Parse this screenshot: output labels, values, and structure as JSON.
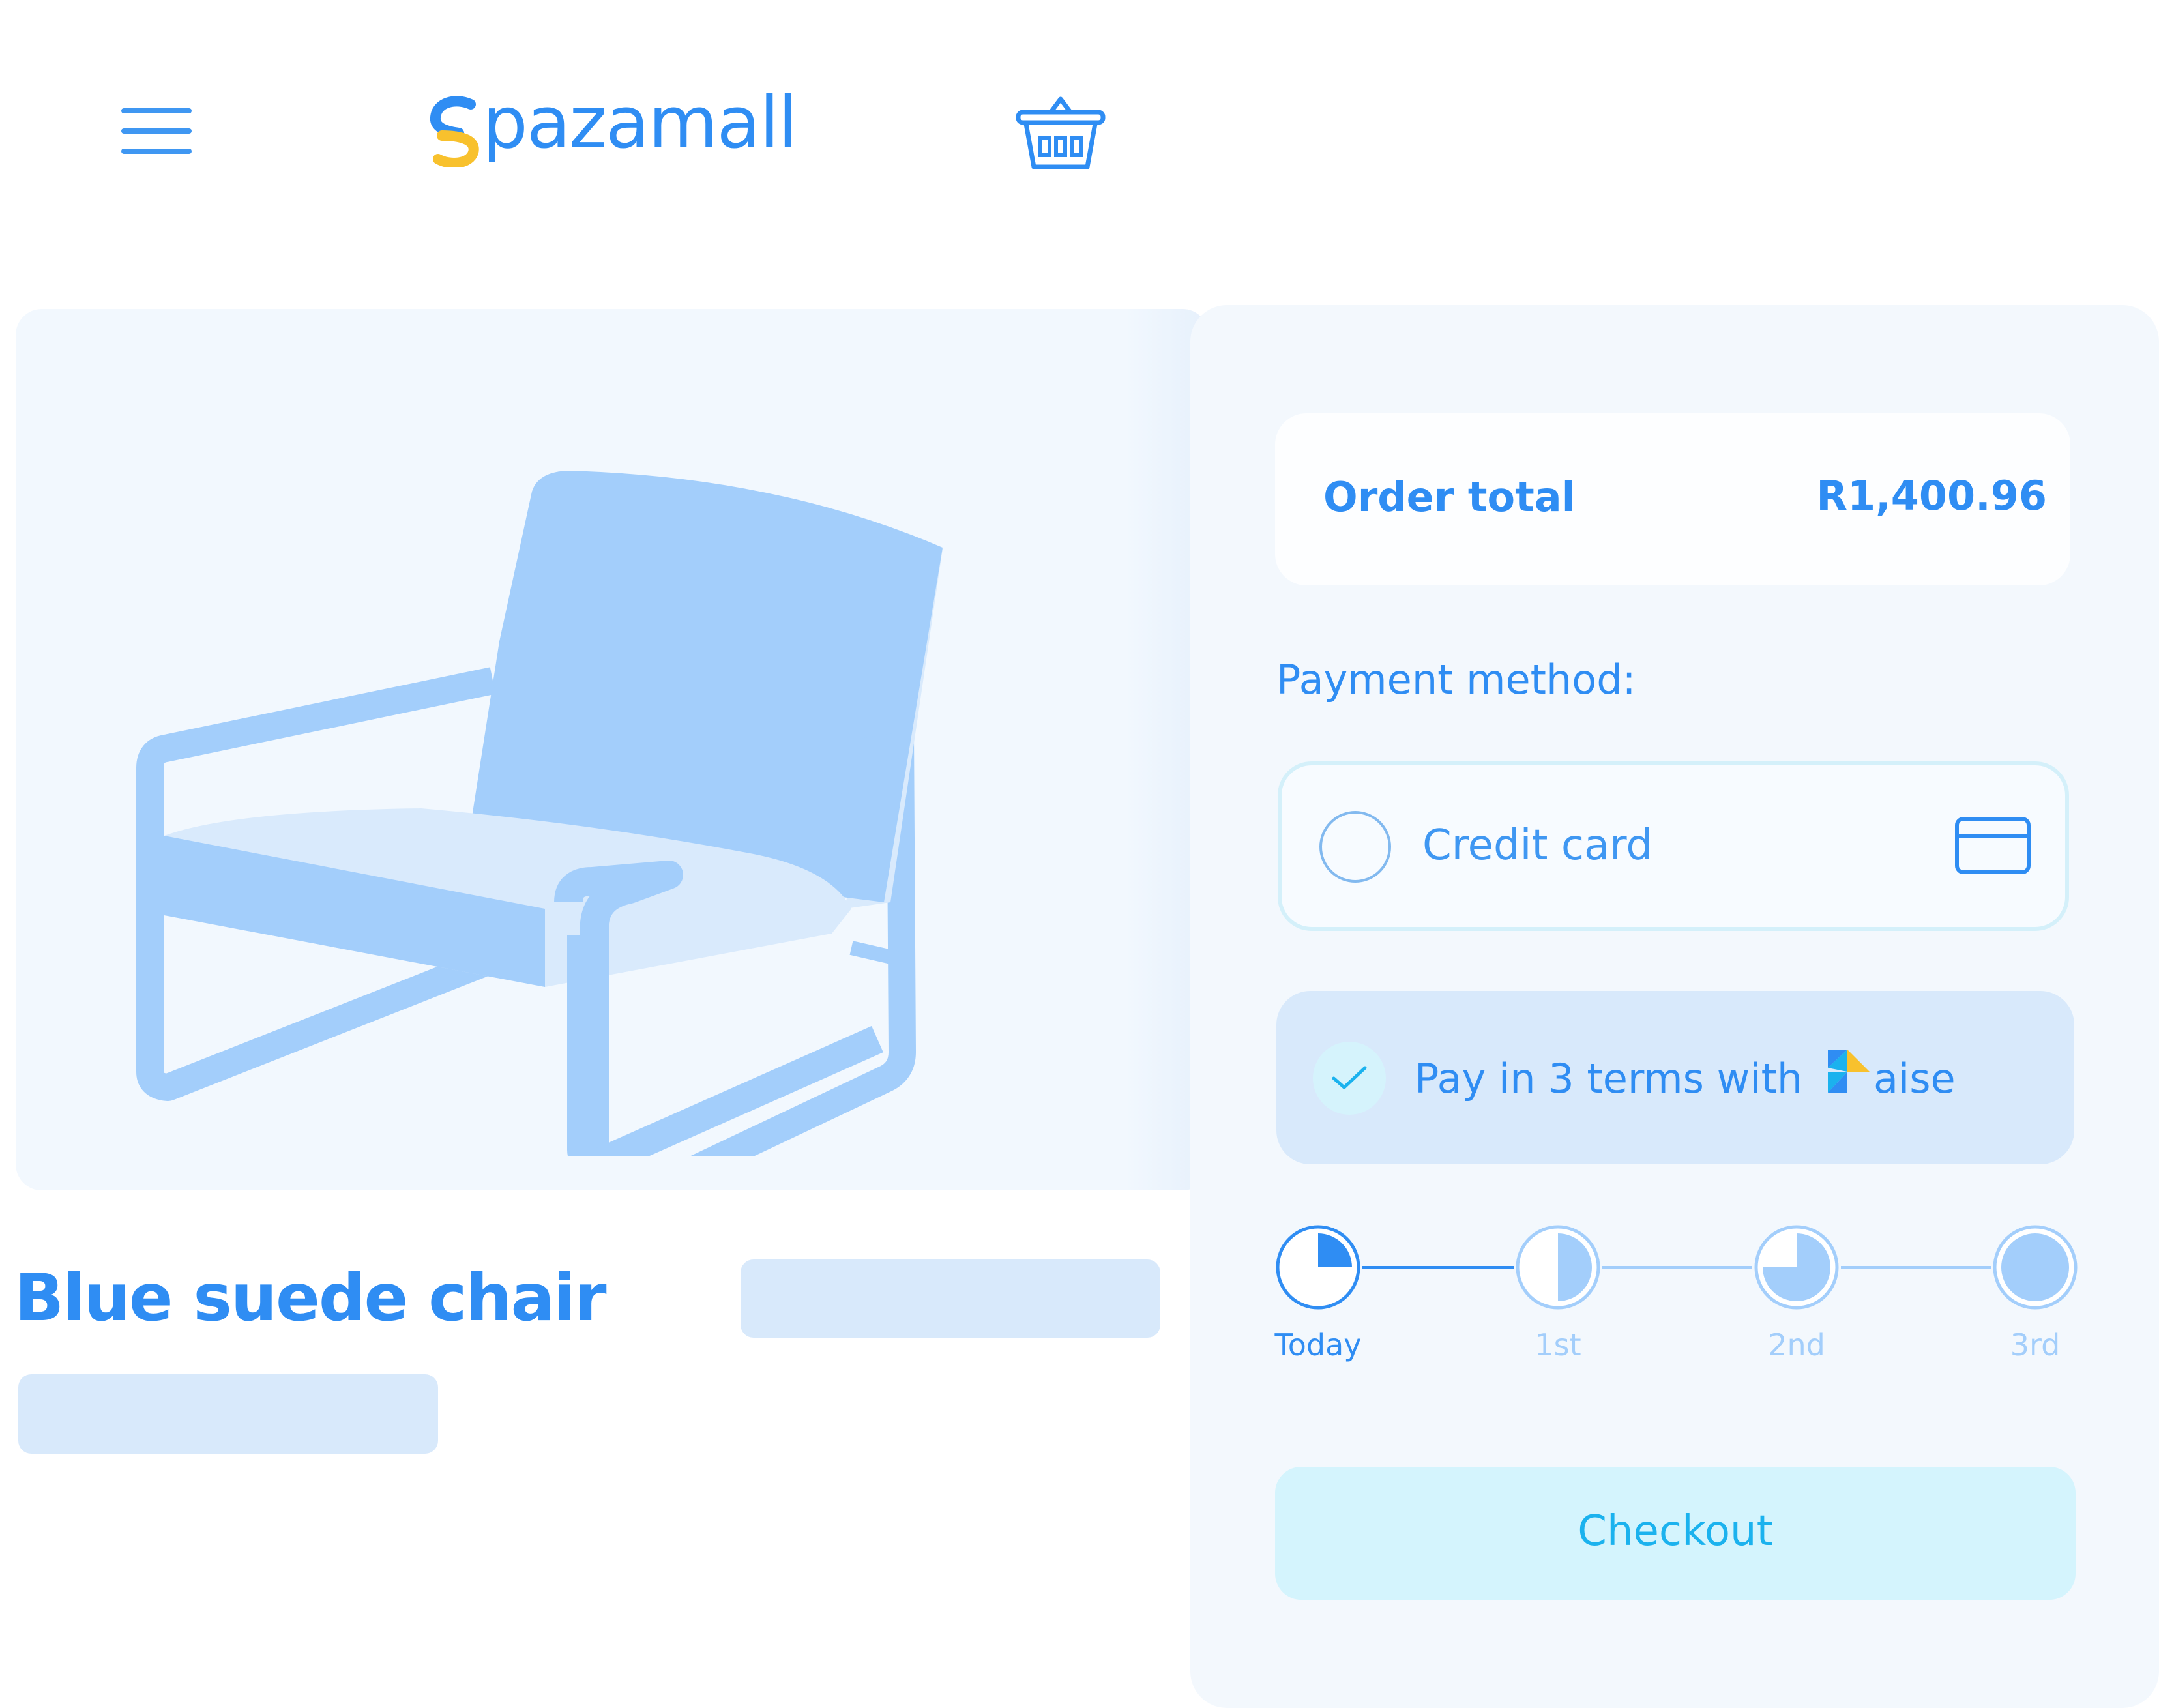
{
  "header": {
    "brand": "pazamall",
    "menu_icon": "hamburger-menu-icon",
    "basket_icon": "shopping-basket-icon"
  },
  "product": {
    "title": "Blue suede chair",
    "image": "armchair-illustration"
  },
  "checkout": {
    "order_total_label": "Order total",
    "order_total_value": "R1,400.96",
    "payment_method_label": "Payment method:",
    "options": [
      {
        "label": "Credit card",
        "selected": false,
        "icon": "credit-card-icon"
      },
      {
        "label": "Pay in 3 terms with",
        "brand": "aise",
        "selected": true,
        "icon": "check-icon"
      }
    ],
    "schedule": [
      {
        "label": "Today",
        "fill": 0.25
      },
      {
        "label": "1st",
        "fill": 0.5
      },
      {
        "label": "2nd",
        "fill": 0.75
      },
      {
        "label": "3rd",
        "fill": 1.0
      }
    ],
    "checkout_label": "Checkout"
  },
  "colors": {
    "primary": "#2f8df3",
    "light_blue": "#a3cefb",
    "panel": "#f3f8fd",
    "checkout_bg": "#d4f4fd",
    "checkout_text": "#1bb2ee",
    "logo_yellow": "#f8c12d"
  }
}
